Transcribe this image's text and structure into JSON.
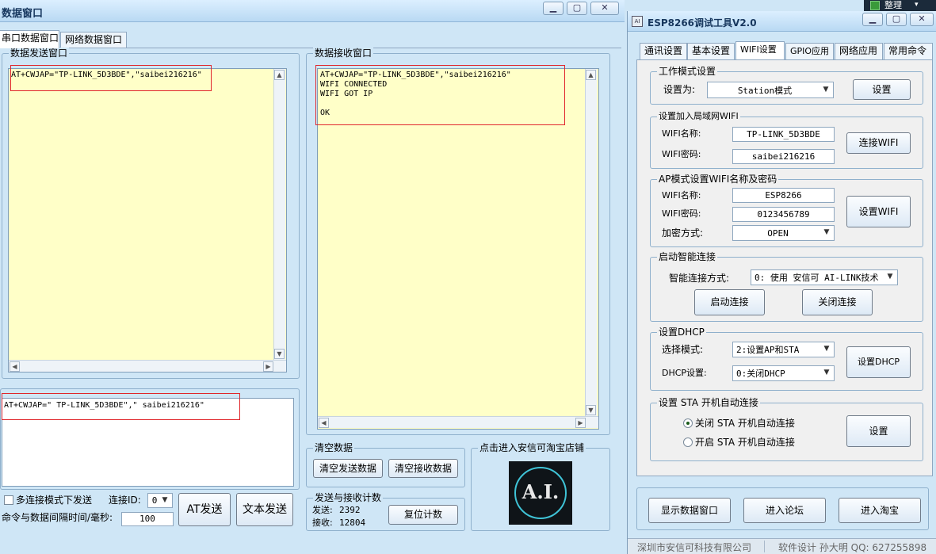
{
  "left_window": {
    "title": "数据窗口",
    "tabs": [
      {
        "label": "串口数据窗口",
        "active": true
      },
      {
        "label": "网络数据窗口",
        "active": false
      }
    ],
    "send_group": {
      "legend": "数据发送窗口",
      "text": "AT+CWJAP=\"TP-LINK_5D3BDE\",\"saibei216216\""
    },
    "recv_group": {
      "legend": "数据接收窗口",
      "text": "AT+CWJAP=\"TP-LINK_5D3BDE\",\"saibei216216\"\nWIFI CONNECTED\nWIFI GOT IP\n\nOK"
    },
    "command_input": "AT+CWJAP=\" TP-LINK_5D3BDE\",\" saibei216216\"",
    "multi_connect_label": "多连接模式下发送",
    "connect_id_label": "连接ID:",
    "connect_id_value": "0",
    "interval_label": "命令与数据间隔时间/毫秒:",
    "interval_value": "100",
    "at_send_label": "AT发送",
    "text_send_label": "文本发送",
    "clear_group": {
      "legend": "清空数据",
      "clear_send": "清空发送数据",
      "clear_recv": "清空接收数据"
    },
    "counter_group": {
      "legend": "发送与接收计数",
      "sent_label": "发送:",
      "sent_value": "2392",
      "recv_label": "接收:",
      "recv_value": "12804",
      "reset_label": "复位计数"
    },
    "shop_group": {
      "legend": "点击进入安信可淘宝店铺",
      "logo_text": "A.I."
    }
  },
  "top_right": {
    "label": "整理"
  },
  "right_window": {
    "title": "ESP8266调试工具V2.0",
    "tabs": [
      {
        "label": "通讯设置",
        "active": false
      },
      {
        "label": "基本设置",
        "active": false
      },
      {
        "label": "WIFI设置",
        "active": true
      },
      {
        "label": "GPIO应用",
        "active": false
      },
      {
        "label": "网络应用",
        "active": false
      },
      {
        "label": "常用命令",
        "active": false
      }
    ],
    "work_mode": {
      "legend": "工作模式设置",
      "label": "设置为:",
      "value": "Station模式",
      "button": "设置"
    },
    "join_wifi": {
      "legend": "设置加入局域网WIFI",
      "name_label": "WIFI名称:",
      "name_value": "TP-LINK_5D3BDE",
      "pwd_label": "WIFI密码:",
      "pwd_value": "saibei216216",
      "button": "连接WIFI"
    },
    "ap_mode": {
      "legend": "AP模式设置WIFI名称及密码",
      "name_label": "WIFI名称:",
      "name_value": "ESP8266",
      "pwd_label": "WIFI密码:",
      "pwd_value": "0123456789",
      "enc_label": "加密方式:",
      "enc_value": "OPEN",
      "button": "设置WIFI"
    },
    "smart": {
      "legend": "启动智能连接",
      "label": "智能连接方式:",
      "value": "0: 使用 安信可 AI-LINK技术",
      "start": "启动连接",
      "stop": "关闭连接"
    },
    "dhcp": {
      "legend": "设置DHCP",
      "mode_label": "选择模式:",
      "mode_value": "2:设置AP和STA",
      "dhcp_label": "DHCP设置:",
      "dhcp_value": "0:关闭DHCP",
      "button": "设置DHCP"
    },
    "sta_auto": {
      "legend": "设置 STA 开机自动连接",
      "opt_off": "关闭 STA 开机自动连接",
      "opt_on": "开启 STA 开机自动连接",
      "button": "设置"
    },
    "bottom": {
      "show_data": "显示数据窗口",
      "forum": "进入论坛",
      "taobao": "进入淘宝"
    },
    "status": {
      "company": "深圳市安信可科技有限公司",
      "author": "软件设计 孙大明 QQ: 627255898"
    }
  }
}
